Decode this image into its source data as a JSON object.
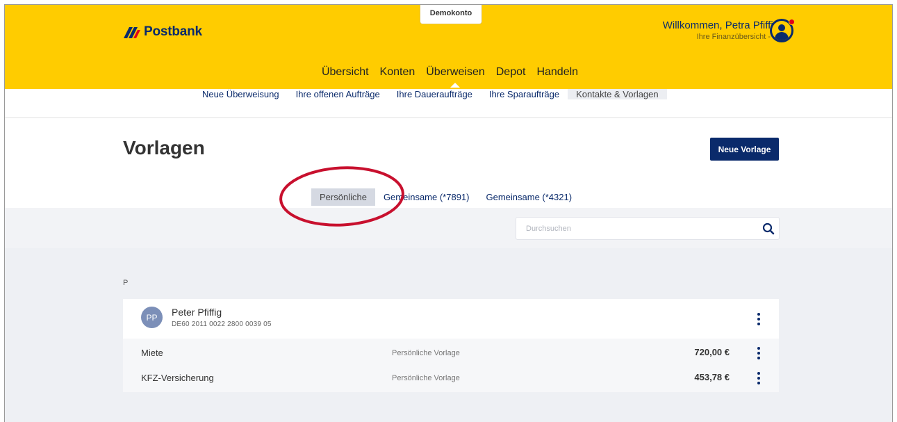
{
  "header": {
    "demo_badge": "Demokonto",
    "brand": "Postbank",
    "welcome_title": "Willkommen, Petra Pfiffig",
    "welcome_sub": "Ihre Finanzübersicht -",
    "brand_yellow": "#ffcc00",
    "brand_blue": "#0a2a6b"
  },
  "mainnav": [
    "Übersicht",
    "Konten",
    "Überweisen",
    "Depot",
    "Handeln"
  ],
  "mainnav_active": "Überweisen",
  "subnav": [
    "Neue Überweisung",
    "Ihre offenen Aufträge",
    "Ihre Daueraufträge",
    "Ihre Sparaufträge",
    "Kontakte & Vorlagen"
  ],
  "subnav_active": "Kontakte & Vorlagen",
  "page": {
    "title": "Vorlagen",
    "new_button": "Neue Vorlage"
  },
  "tabs": [
    "Persönliche",
    "Gemeinsame (*7891)",
    "Gemeinsame (*4321)"
  ],
  "tabs_active": "Persönliche",
  "search": {
    "placeholder": "Durchsuchen",
    "value": ""
  },
  "group_letter": "P",
  "contact": {
    "initials": "PP",
    "name": "Peter Pfiffig",
    "iban": "DE60 2011 0022 2800 0039 05"
  },
  "templates": [
    {
      "name": "Miete",
      "type": "Persönliche Vorlage",
      "amount": "720,00 €"
    },
    {
      "name": "KFZ-Versicherung",
      "type": "Persönliche Vorlage",
      "amount": "453,78 €"
    }
  ],
  "annotation_color": "#c8102e"
}
